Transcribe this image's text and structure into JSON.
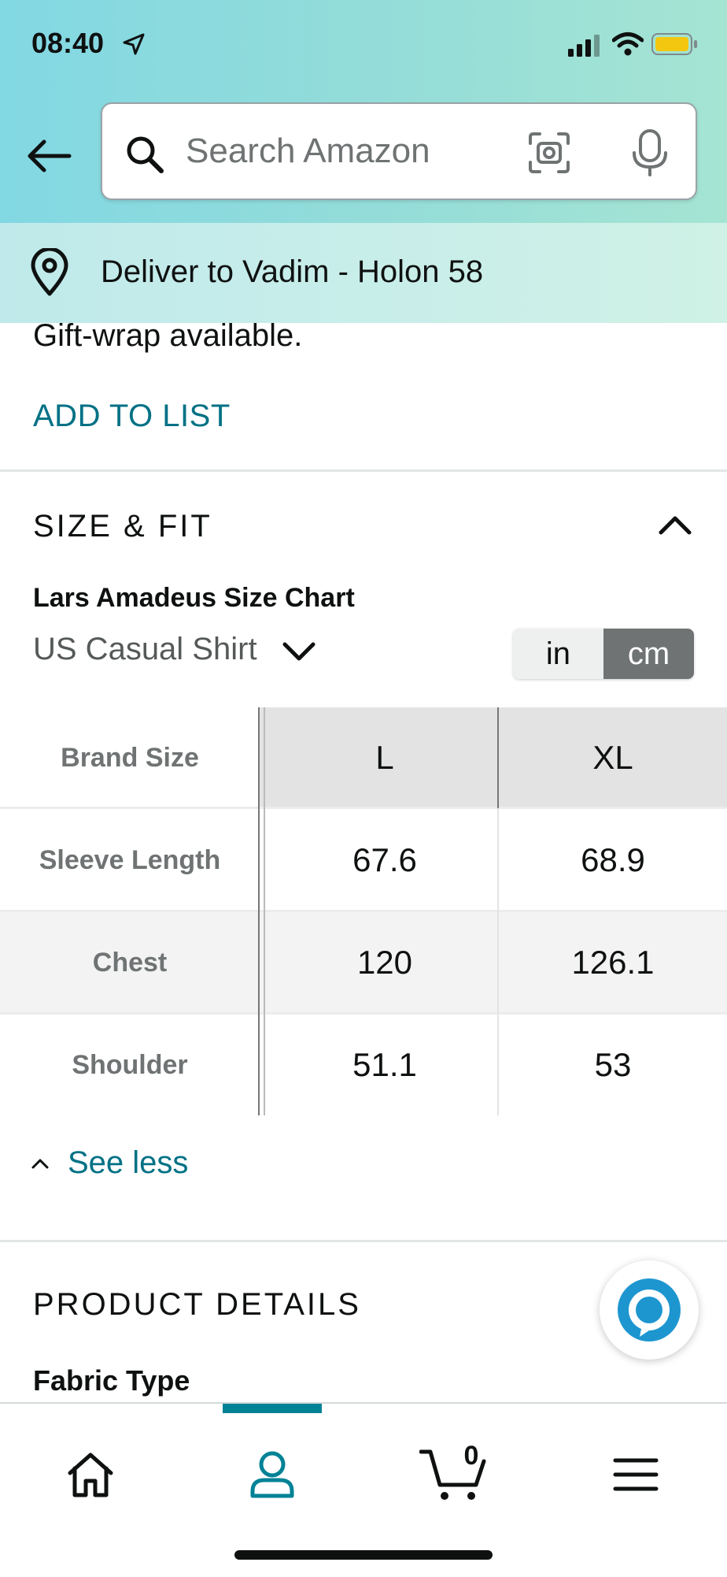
{
  "status_bar": {
    "time": "08:40"
  },
  "search": {
    "placeholder": "Search Amazon"
  },
  "delivery": {
    "text": "Deliver to Vadim - Holon 58"
  },
  "product": {
    "gift_wrap": "Gift-wrap available.",
    "add_to_list": "ADD TO LIST"
  },
  "size_fit": {
    "title": "SIZE & FIT",
    "chart_name": "Lars Amadeus Size Chart",
    "chart_type": "US Casual Shirt",
    "units": {
      "in": "in",
      "cm": "cm",
      "selected": "cm"
    },
    "table": {
      "header": {
        "label": "Brand Size",
        "cols": [
          "L",
          "XL"
        ]
      },
      "rows": [
        {
          "label": "Sleeve Length",
          "values": [
            "67.6",
            "68.9"
          ]
        },
        {
          "label": "Chest",
          "values": [
            "120",
            "126.1"
          ]
        },
        {
          "label": "Shoulder",
          "values": [
            "51.1",
            "53"
          ]
        }
      ]
    },
    "see_less": "See less"
  },
  "product_details": {
    "title": "PRODUCT DETAILS",
    "first_field": "Fabric Type"
  },
  "bottom_nav": {
    "cart_count": "0",
    "active": "account"
  },
  "colors": {
    "link": "#007185",
    "accent": "#008296",
    "alexa": "#1d96d0",
    "battery": "#f3c70f"
  }
}
